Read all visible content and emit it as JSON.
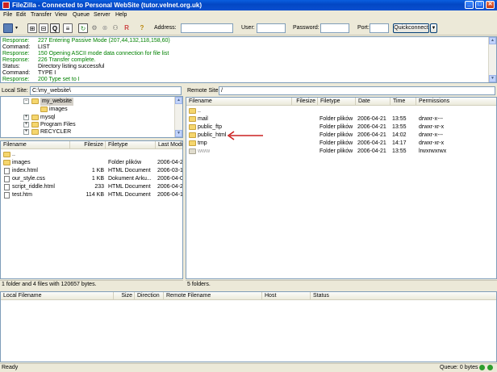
{
  "window": {
    "title": "FileZilla - Connected to Personal WebSite (tutor.velnet.org.uk)",
    "minimize": "_",
    "maximize": "□",
    "close": "✕"
  },
  "menu": [
    "File",
    "Edit",
    "Transfer",
    "View",
    "Queue",
    "Server",
    "Help"
  ],
  "toolbar": {
    "icons": [
      "site-manager-icon",
      "dropdown-arrow-icon",
      "local-tree-icon",
      "remote-tree-icon",
      "message-log-icon",
      "queue-icon",
      "refresh-icon",
      "process-queue-icon",
      "cancel-icon",
      "disconnect-icon",
      "reconnect-icon",
      "help-icon"
    ],
    "address_label": "Address:",
    "address_value": "",
    "user_label": "User:",
    "user_value": "",
    "password_label": "Password:",
    "password_value": "",
    "port_label": "Port:",
    "port_value": "",
    "quickconnect_label": "Quickconnect",
    "quickconnect_arrow": "▼"
  },
  "log": [
    {
      "label": "Response:",
      "msg": "227 Entering Passive Mode (207,44,132,118,158,60)",
      "color": "green"
    },
    {
      "label": "Command:",
      "msg": "LIST",
      "color": "black"
    },
    {
      "label": "Response:",
      "msg": "150 Opening ASCII mode data connection for file list",
      "color": "green"
    },
    {
      "label": "Response:",
      "msg": "226 Transfer complete.",
      "color": "green"
    },
    {
      "label": "Status:",
      "msg": "Directory listing successful",
      "color": "black"
    },
    {
      "label": "Command:",
      "msg": "TYPE I",
      "color": "black"
    },
    {
      "label": "Response:",
      "msg": "200 Type set to I",
      "color": "green"
    }
  ],
  "local": {
    "site_label": "Local Site:",
    "site_path": "C:\\my_website\\",
    "tree": [
      {
        "name": "my_website",
        "expander": "−",
        "selected": true
      },
      {
        "name": "images",
        "expander": "",
        "selected": false
      },
      {
        "name": "mysql",
        "expander": "+",
        "selected": false
      },
      {
        "name": "Program Files",
        "expander": "+",
        "selected": false
      },
      {
        "name": "RECYCLER",
        "expander": "+",
        "selected": false
      }
    ],
    "columns": [
      "Filename",
      "Filesize",
      "Filetype",
      "Last Modif"
    ],
    "files": [
      {
        "name": "..",
        "size": "",
        "type": "",
        "date": "",
        "icon": "folder"
      },
      {
        "name": "images",
        "size": "",
        "type": "Folder plików",
        "date": "2006-04-21",
        "icon": "folder"
      },
      {
        "name": "index.html",
        "size": "1 KB",
        "type": "HTML Document",
        "date": "2006-03-1",
        "icon": "file"
      },
      {
        "name": "our_style.css",
        "size": "1 KB",
        "type": "Dokument Arku...",
        "date": "2006-04-0",
        "icon": "file"
      },
      {
        "name": "script_riddle.html",
        "size": "233",
        "type": "HTML Document",
        "date": "2006-04-2",
        "icon": "file"
      },
      {
        "name": "test.htm",
        "size": "114 KB",
        "type": "HTML Document",
        "date": "2006-04-1",
        "icon": "file"
      }
    ],
    "status": "1 folder and 4 files with 120657 bytes."
  },
  "remote": {
    "site_label": "Remote Site:",
    "site_path": "/",
    "columns": [
      "Filename",
      "Filesize",
      "Filetype",
      "Date",
      "Time",
      "Permissions"
    ],
    "files": [
      {
        "name": "..",
        "type": "",
        "date": "",
        "time": "",
        "perm": "",
        "gray": false
      },
      {
        "name": "mail",
        "type": "Folder plików",
        "date": "2006-04-21",
        "time": "13:55",
        "perm": "drwxr-x---",
        "gray": false
      },
      {
        "name": "public_ftp",
        "type": "Folder plików",
        "date": "2006-04-21",
        "time": "13:55",
        "perm": "drwxr-xr-x",
        "gray": false
      },
      {
        "name": "public_html",
        "type": "Folder plików",
        "date": "2006-04-21",
        "time": "14:02",
        "perm": "drwxr-x---",
        "gray": false
      },
      {
        "name": "tmp",
        "type": "Folder plików",
        "date": "2006-04-21",
        "time": "14:17",
        "perm": "drwxr-xr-x",
        "gray": false
      },
      {
        "name": "www",
        "type": "Folder plików",
        "date": "2006-04-21",
        "time": "13:55",
        "perm": "lrwxrwxrwx",
        "gray": true
      }
    ],
    "status": "5 folders."
  },
  "queue": {
    "columns": [
      "Local Filename",
      "Size",
      "Direction",
      "Remote Filename",
      "Host",
      "Status"
    ]
  },
  "statusbar": {
    "left": "Ready",
    "right": "Queue: 0 bytes"
  },
  "colors": {
    "annotation_arrow": "#cc2222"
  }
}
